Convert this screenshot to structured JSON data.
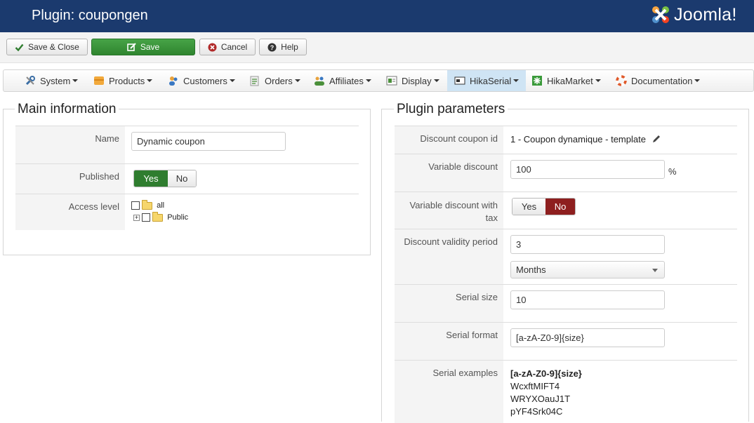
{
  "header": {
    "title": "Plugin: coupongen",
    "logo_text": "Joomla!"
  },
  "toolbar": {
    "save_close": "Save & Close",
    "save": "Save",
    "cancel": "Cancel",
    "help": "Help"
  },
  "menu": {
    "items": [
      {
        "label": "System",
        "icon": "wrench-icon"
      },
      {
        "label": "Products",
        "icon": "products-icon"
      },
      {
        "label": "Customers",
        "icon": "customers-icon"
      },
      {
        "label": "Orders",
        "icon": "orders-icon"
      },
      {
        "label": "Affiliates",
        "icon": "affiliates-icon"
      },
      {
        "label": "Display",
        "icon": "display-icon"
      },
      {
        "label": "HikaSerial",
        "icon": "hikaserial-icon",
        "active": true
      },
      {
        "label": "HikaMarket",
        "icon": "hikamarket-icon"
      },
      {
        "label": "Documentation",
        "icon": "lifebuoy-icon"
      }
    ]
  },
  "main_info": {
    "legend": "Main information",
    "name_label": "Name",
    "name_value": "Dynamic coupon",
    "published_label": "Published",
    "published_yes": "Yes",
    "published_no": "No",
    "published_value": "Yes",
    "access_label": "Access level",
    "access_tree": [
      "all",
      "Public"
    ]
  },
  "plugin_params": {
    "legend": "Plugin parameters",
    "coupon_id_label": "Discount coupon id",
    "coupon_id_value": "1 - Coupon dynamique - template",
    "variable_discount_label": "Variable discount",
    "variable_discount_value": "100",
    "variable_discount_unit": "%",
    "variable_tax_label": "Variable discount with tax",
    "variable_tax_yes": "Yes",
    "variable_tax_no": "No",
    "variable_tax_value": "No",
    "validity_label": "Discount validity period",
    "validity_value": "3",
    "validity_unit": "Months",
    "serial_size_label": "Serial size",
    "serial_size_value": "10",
    "serial_format_label": "Serial format",
    "serial_format_value": "[a-zA-Z0-9]{size}",
    "serial_examples_label": "Serial examples",
    "serial_examples_format": "[a-zA-Z0-9]{size}",
    "serial_examples": [
      "WcxftMIFT4",
      "WRYXOauJ1T",
      "pYF4Srk04C"
    ]
  },
  "colors": {
    "header_bg": "#1b3a6e",
    "save_green": "#2f852f",
    "yes_selected": "#2f7d2f",
    "no_selected": "#8e1f1f",
    "menu_active": "#cfe4f4"
  }
}
